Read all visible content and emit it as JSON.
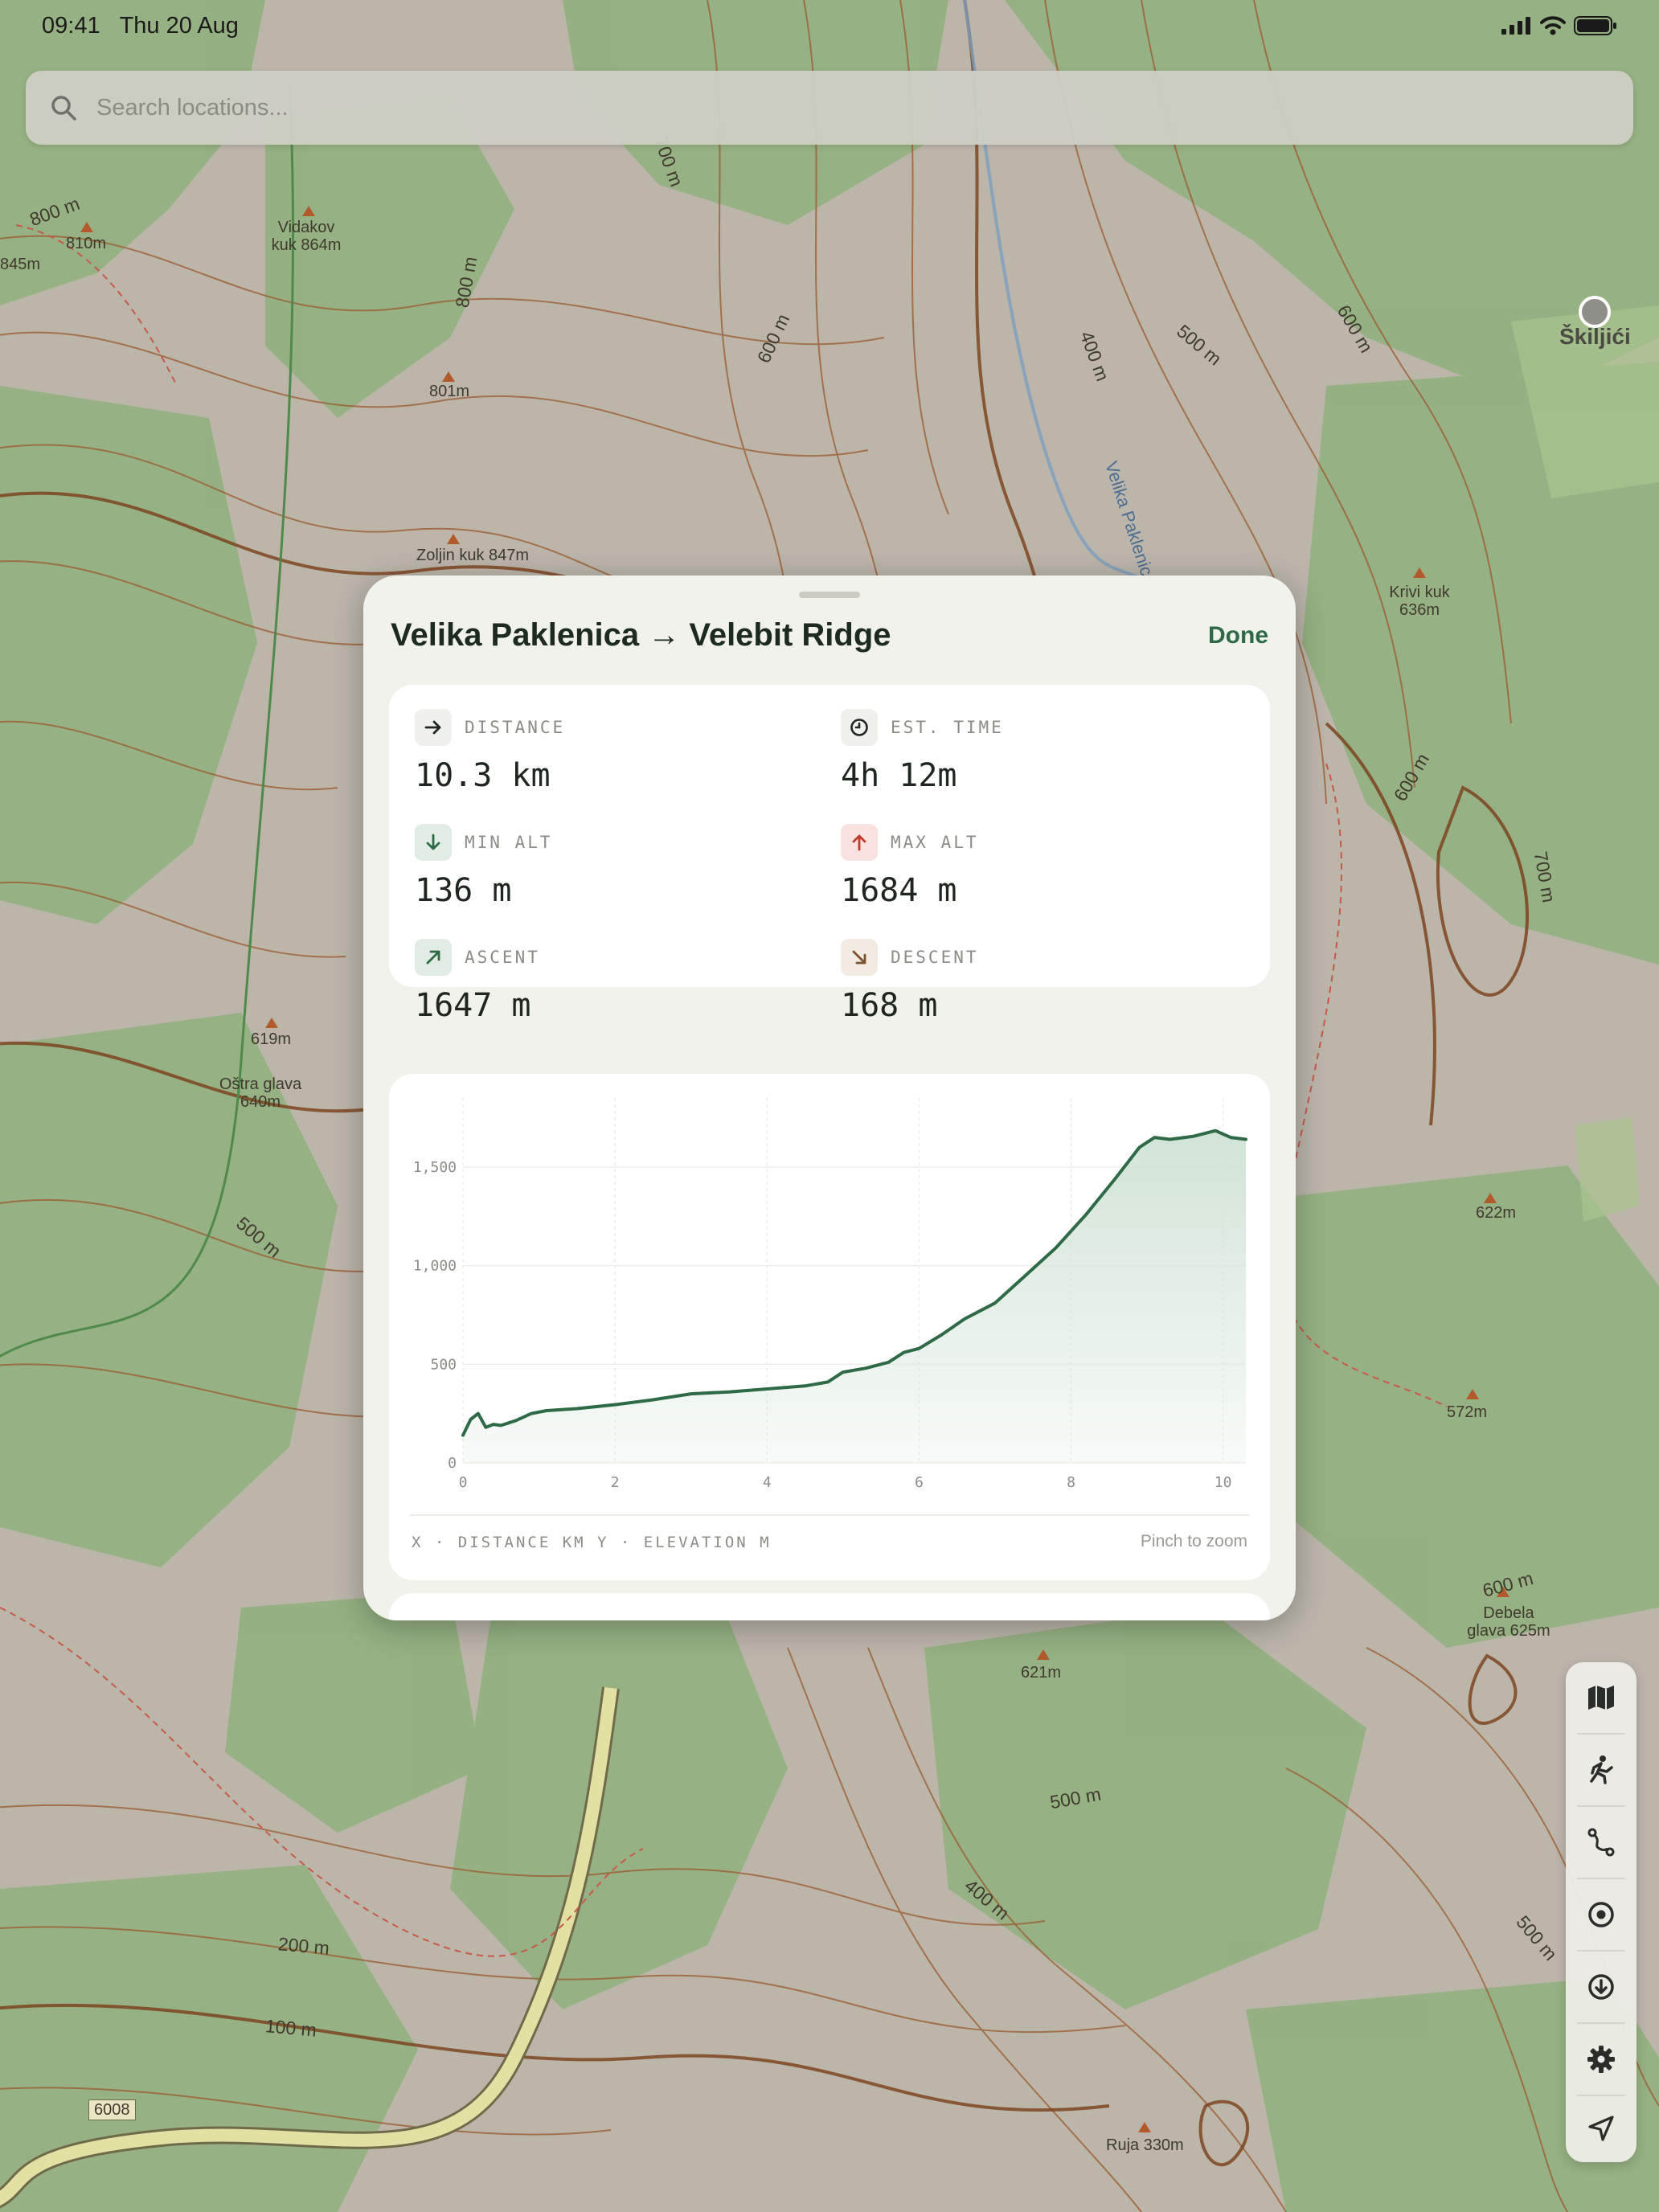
{
  "status_bar": {
    "time": "09:41",
    "date": "Thu 20 Aug"
  },
  "search": {
    "placeholder": "Search locations..."
  },
  "map_labels": {
    "vidakov_kuk": "Vidakov kuk 864m",
    "p810": "810m",
    "p845": "845m",
    "p801": "801m",
    "zoljin_kuk": "Zoljin kuk 847m",
    "p619": "619m",
    "ostra_glava": "Oštra glava 640m",
    "krivi_kuk": "Krivi kuk 636m",
    "p622": "622m",
    "p572": "572m",
    "debela_glava": "Debela glava 625m",
    "p621": "621m",
    "ruja": "Ruja 330m",
    "road_number": "6008",
    "skiljici": "Škiljići",
    "velika_paklenica_river": "Velika Paklenica",
    "c800": "800 m",
    "c700": "700 m",
    "c600": "600 m",
    "c500": "500 m",
    "c400": "400 m",
    "c200": "200 m",
    "c100": "100 m"
  },
  "route_sheet": {
    "title": "Velika Paklenica → Velebit Ridge",
    "done_label": "Done",
    "stats": [
      {
        "icon": "arrow-right-icon",
        "label": "DISTANCE",
        "value": "10.3 km",
        "icon_bg": "#f0f0ec",
        "icon_color": "#1f2620"
      },
      {
        "icon": "clock-icon",
        "label": "EST. TIME",
        "value": "4h 12m",
        "icon_bg": "#f0f0ec",
        "icon_color": "#1f2620"
      },
      {
        "icon": "arrow-down-icon",
        "label": "MIN ALT",
        "value": "136 m",
        "icon_bg": "#e1ece4",
        "icon_color": "#2e6a45"
      },
      {
        "icon": "arrow-up-icon",
        "label": "MAX ALT",
        "value": "1684 m",
        "icon_bg": "#f8e1de",
        "icon_color": "#c0392b"
      },
      {
        "icon": "arrow-up-right-icon",
        "label": "ASCENT",
        "value": "1647 m",
        "icon_bg": "#e1ece4",
        "icon_color": "#2e6a45"
      },
      {
        "icon": "arrow-down-right-icon",
        "label": "DESCENT",
        "value": "168 m",
        "icon_bg": "#f1ebe2",
        "icon_color": "#7a5230"
      }
    ],
    "axis_caption": "X · DISTANCE KM   Y · ELEVATION M",
    "zoom_hint": "Pinch to zoom"
  },
  "chart_data": {
    "type": "area",
    "title": "",
    "xlabel": "DISTANCE KM",
    "ylabel": "ELEVATION M",
    "xlim": [
      0,
      10.3
    ],
    "ylim": [
      0,
      1850
    ],
    "x_ticks": [
      0,
      2,
      4,
      6,
      8,
      10
    ],
    "y_ticks": [
      0,
      500,
      1000,
      1500
    ],
    "y_tick_labels": [
      "0",
      "500",
      "1,000",
      "1,500"
    ],
    "grid": true,
    "series": [
      {
        "x": [
          0,
          0.1,
          0.2,
          0.3,
          0.4,
          0.5,
          0.7,
          0.9,
          1.1,
          1.5,
          2.0,
          2.5,
          3.0,
          3.5,
          4.0,
          4.5,
          4.8,
          5.0,
          5.3,
          5.6,
          5.8,
          6.0,
          6.3,
          6.6,
          7.0,
          7.4,
          7.8,
          8.2,
          8.6,
          8.9,
          9.1,
          9.3,
          9.6,
          9.9,
          10.1,
          10.3
        ],
        "y": [
          140,
          220,
          250,
          180,
          195,
          190,
          215,
          250,
          265,
          275,
          295,
          320,
          350,
          360,
          375,
          390,
          410,
          460,
          480,
          510,
          560,
          580,
          650,
          730,
          810,
          950,
          1090,
          1260,
          1450,
          1600,
          1650,
          1640,
          1655,
          1684,
          1650,
          1640
        ]
      }
    ],
    "colors": {
      "line": "#2e6a45",
      "fill": "#cfe2d5"
    }
  },
  "toolbar": {
    "items": [
      {
        "icon": "map-icon"
      },
      {
        "icon": "hiker-icon"
      },
      {
        "icon": "route-icon"
      },
      {
        "icon": "target-icon"
      },
      {
        "icon": "download-icon"
      },
      {
        "icon": "gear-icon"
      },
      {
        "icon": "location-arrow-icon"
      }
    ]
  },
  "colors": {
    "accent": "#2e6a45",
    "map_green": "#8db07a",
    "map_bare": "#b9b3a8",
    "contour": "#9a5a2e"
  }
}
